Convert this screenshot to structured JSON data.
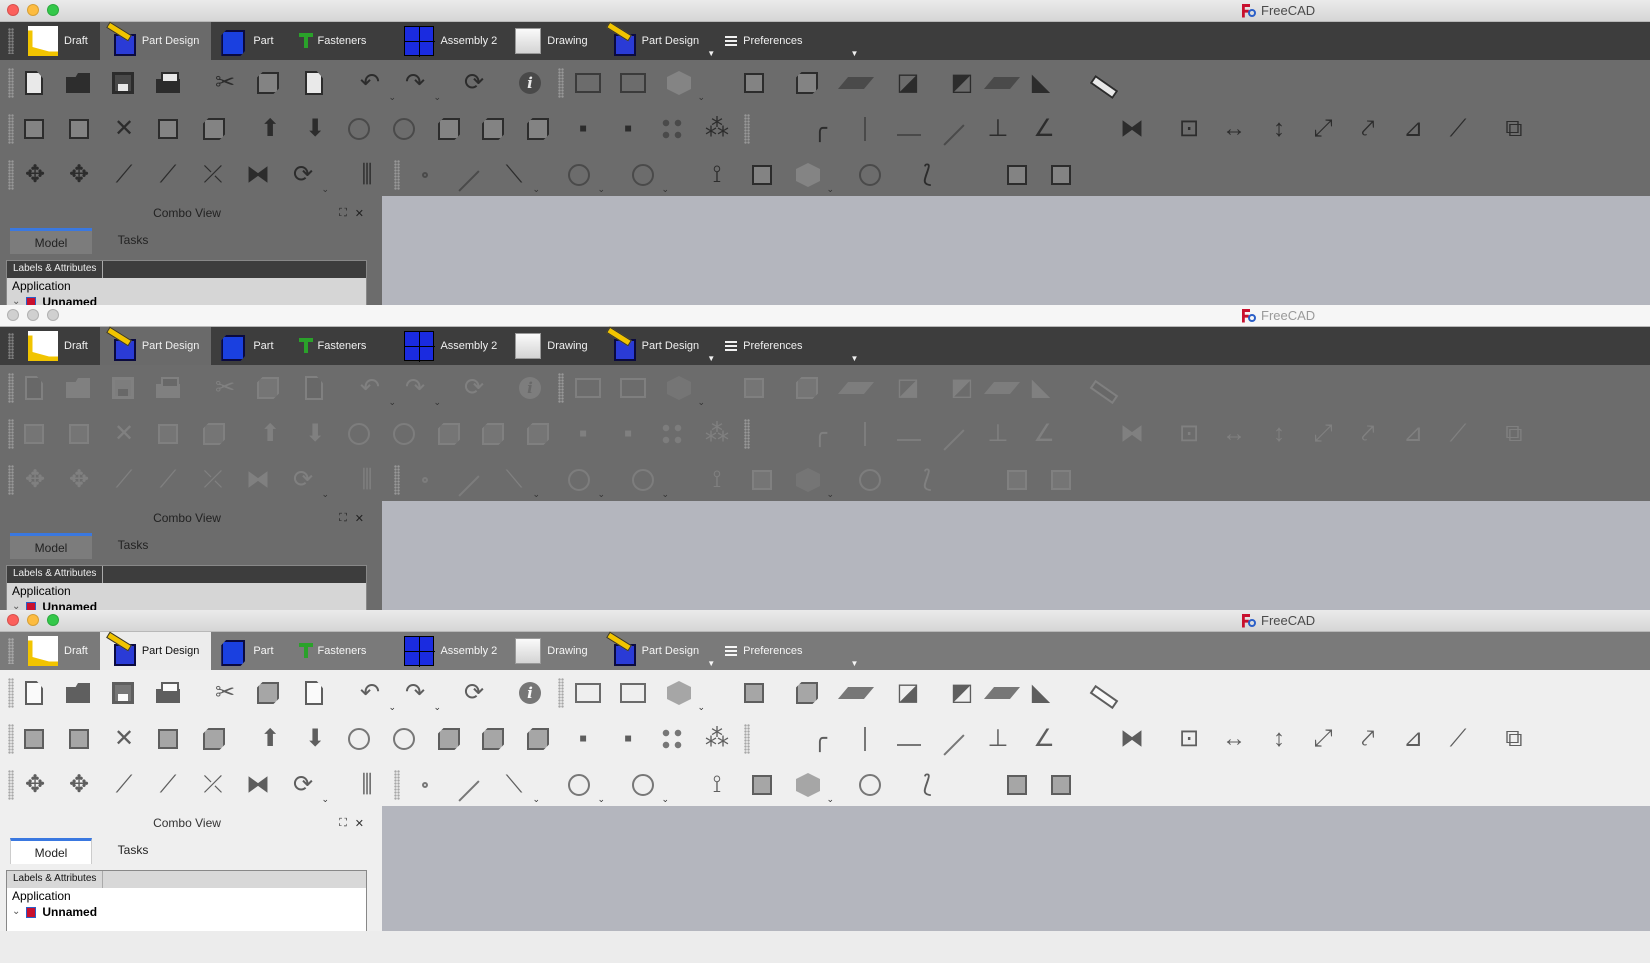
{
  "app_title": "FreeCAD",
  "workbench_tabs": [
    {
      "label": "Draft",
      "icon": "draft-workbench-icon"
    },
    {
      "label": "Part Design",
      "icon": "part-design-workbench-icon",
      "active": true
    },
    {
      "label": "Part",
      "icon": "part-workbench-icon"
    },
    {
      "label": "Fasteners",
      "icon": "fasteners-workbench-icon"
    },
    {
      "label": "Assembly 2",
      "icon": "assembly2-workbench-icon"
    },
    {
      "label": "Drawing",
      "icon": "drawing-workbench-icon"
    },
    {
      "label": "Part Design",
      "icon": "part-design-workbench-icon"
    },
    {
      "label": "Preferences",
      "icon": "hamburger-menu-icon"
    }
  ],
  "combo_view": {
    "title": "Combo View",
    "tabs": [
      "Model",
      "Tasks"
    ],
    "active_tab": "Model",
    "tree_header": "Labels & Attributes",
    "tree_root": "Application",
    "tree_item": "Unnamed"
  },
  "windows": [
    {
      "theme": "dark",
      "traffic_lights": "active",
      "title_dimmed": false
    },
    {
      "theme": "dark-inactive",
      "traffic_lights": "inactive",
      "title_dimmed": true
    },
    {
      "theme": "light",
      "traffic_lights": "active",
      "title_dimmed": false
    }
  ],
  "colors": {
    "dark_toolbar": "#6c6c6c",
    "tab_bar_dark": "#3d3d3d",
    "view3d_background": "#b4b6be",
    "active_tab_accent": "#3a78e0"
  }
}
